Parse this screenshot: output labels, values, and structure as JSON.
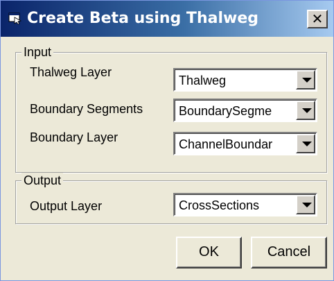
{
  "window": {
    "title": "Create Beta using Thalweg",
    "close_glyph": "✕"
  },
  "input_group": {
    "legend": "Input",
    "thalweg_layer": {
      "label": "Thalweg Layer",
      "value": "Thalweg"
    },
    "boundary_segments": {
      "label": "Boundary Segments",
      "value": "BoundarySegme"
    },
    "boundary_layer": {
      "label": "Boundary Layer",
      "value": "ChannelBoundar"
    }
  },
  "output_group": {
    "legend": "Output",
    "output_layer": {
      "label": "Output Layer",
      "value": "CrossSections"
    }
  },
  "buttons": {
    "ok": "OK",
    "cancel": "Cancel"
  },
  "icons": {
    "app": "app-window-icon",
    "dropdown": "chevron-down-icon",
    "close": "close-icon"
  },
  "colors": {
    "titlebar_start": "#0a246a",
    "titlebar_end": "#a6caf0",
    "dialog_bg": "#ece9d8"
  }
}
